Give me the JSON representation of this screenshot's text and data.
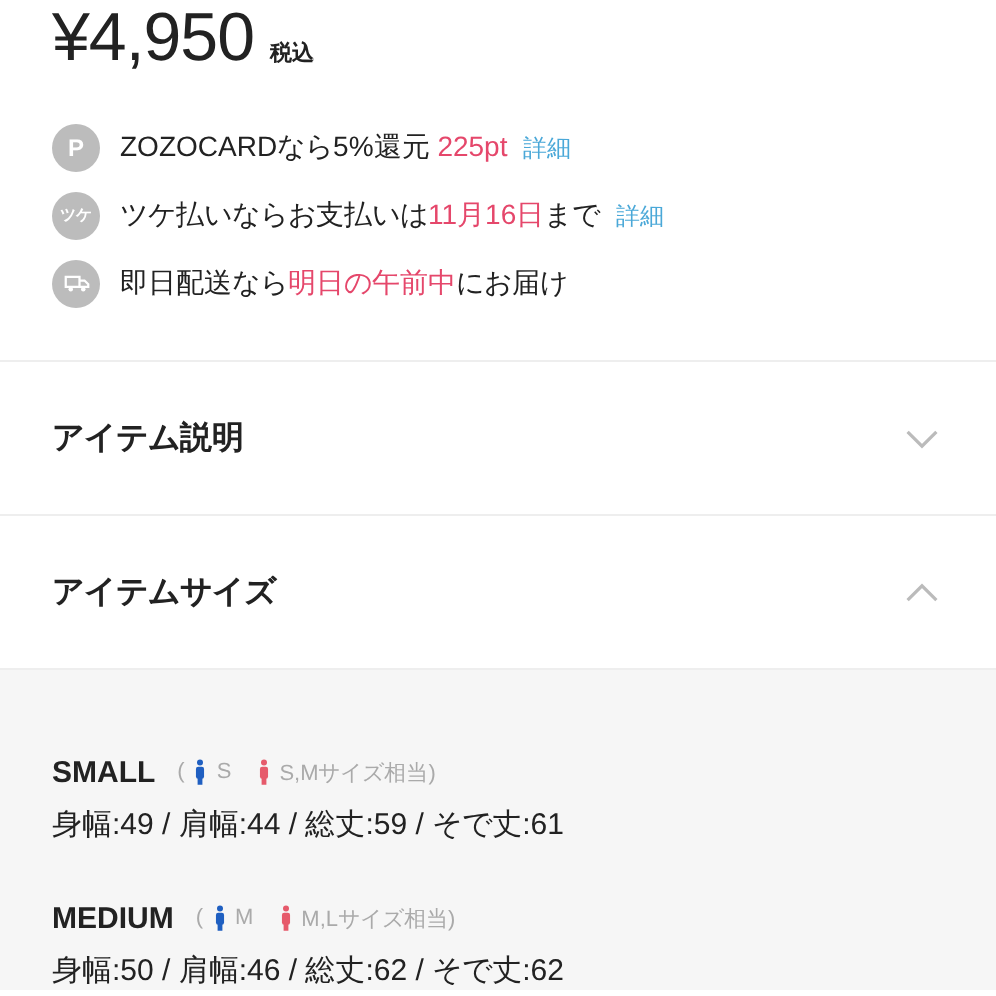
{
  "price": {
    "amount": "¥4,950",
    "tax": "税込"
  },
  "benefits": [
    {
      "kind": "point",
      "glyph": "P",
      "parts": [
        {
          "kind": "plain",
          "text": "ZOZOCARDなら5%還元 "
        },
        {
          "kind": "accent",
          "text": "225pt"
        },
        {
          "kind": "link",
          "text": "詳細"
        }
      ]
    },
    {
      "kind": "tsuke",
      "glyph": "ツケ",
      "parts": [
        {
          "kind": "plain",
          "text": "ツケ払いならお支払いは"
        },
        {
          "kind": "accent",
          "text": "11月16日"
        },
        {
          "kind": "plain",
          "text": "まで"
        },
        {
          "kind": "link",
          "text": "詳細"
        }
      ]
    },
    {
      "kind": "truck",
      "parts": [
        {
          "kind": "plain",
          "text": "即日配送なら"
        },
        {
          "kind": "accent",
          "text": "明日の午前中"
        },
        {
          "kind": "plain",
          "text": "にお届け"
        }
      ]
    }
  ],
  "sections": [
    {
      "title": "アイテム説明",
      "expanded": false
    },
    {
      "title": "アイテムサイズ",
      "expanded": true
    }
  ],
  "sizes": [
    {
      "name": "SMALL",
      "paren": "(",
      "men": "S",
      "women": "S,Mサイズ相当)",
      "measures": "身幅:49 / 肩幅:44 / 総丈:59 / そで丈:61"
    },
    {
      "name": "MEDIUM",
      "paren": "(",
      "men": "M",
      "women": "M,Lサイズ相当)",
      "measures": "身幅:50 / 肩幅:46 / 総丈:62 / そで丈:62"
    }
  ]
}
